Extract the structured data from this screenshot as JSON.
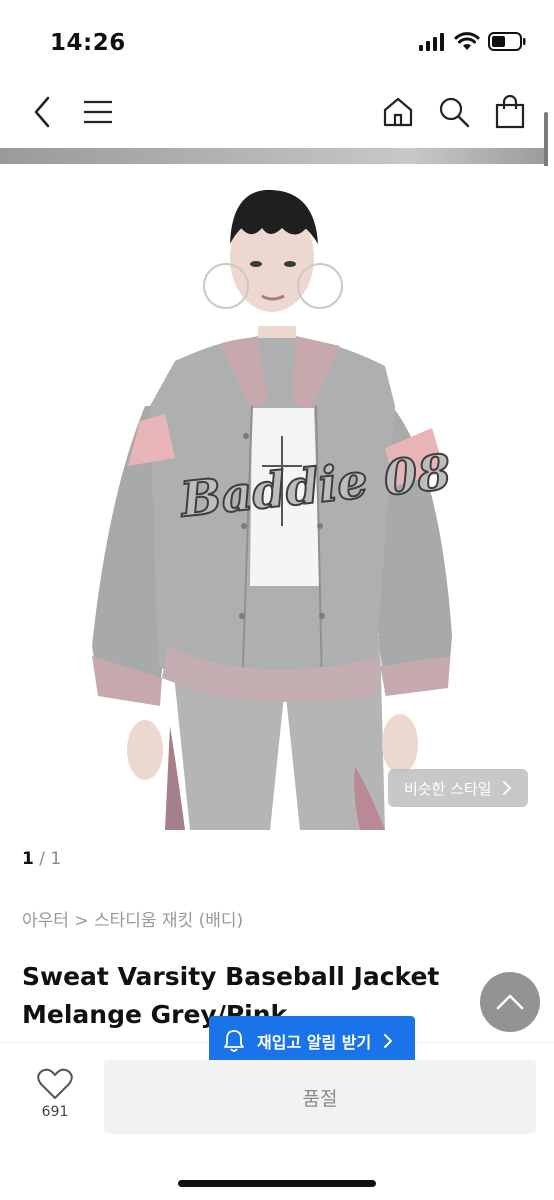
{
  "status_bar": {
    "time": "14:26",
    "icons": [
      "signal-icon",
      "wifi-icon",
      "battery-icon"
    ],
    "battery_level": 0.45
  },
  "nav": {
    "icons": [
      "back-icon",
      "menu-icon",
      "home-icon",
      "search-icon",
      "shopping-bag-icon"
    ]
  },
  "gallery": {
    "current": "1",
    "separator": "/",
    "total": "1",
    "similar_style_label": "비슷한 스타일"
  },
  "product": {
    "breadcrumb": "아우터 > 스타디움 재킷 (배디)",
    "title": "Sweat Varsity Baseball Jacket Melange Grey/Pink",
    "jacket_text": "Baddie 08"
  },
  "bottom_bar": {
    "restock_label": "재입고 알림 받기",
    "like_count": "691",
    "soldout_label": "품절"
  },
  "colors": {
    "accent": "#1a73e8",
    "jacket_grey": "#a9aaab",
    "jacket_pink": "#e8b2b8",
    "text": "#111111",
    "muted": "#999999"
  }
}
